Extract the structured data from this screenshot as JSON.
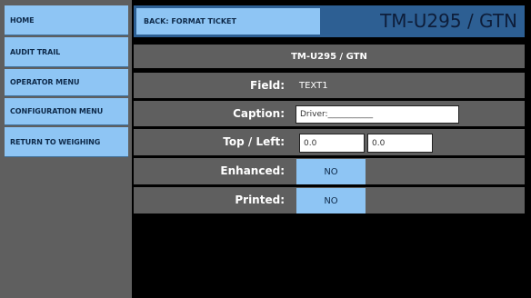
{
  "sidebar": {
    "items": [
      {
        "label": "HOME"
      },
      {
        "label": "AUDIT TRAIL"
      },
      {
        "label": "OPERATOR MENU"
      },
      {
        "label": "CONFIGURATION MENU"
      },
      {
        "label": "RETURN TO WEIGHING"
      }
    ]
  },
  "header": {
    "back_label": "BACK: FORMAT TICKET",
    "device_title": "TM-U295 / GTN"
  },
  "form": {
    "title": "TM-U295 / GTN",
    "field_label": "Field:",
    "field_value": "TEXT1",
    "caption_label": "Caption:",
    "caption_value": "Driver:___________",
    "topleft_label": "Top / Left:",
    "top_value": "0.0",
    "left_value": "0.0",
    "enhanced_label": "Enhanced:",
    "enhanced_value": "NO",
    "printed_label": "Printed:",
    "printed_value": "NO"
  }
}
